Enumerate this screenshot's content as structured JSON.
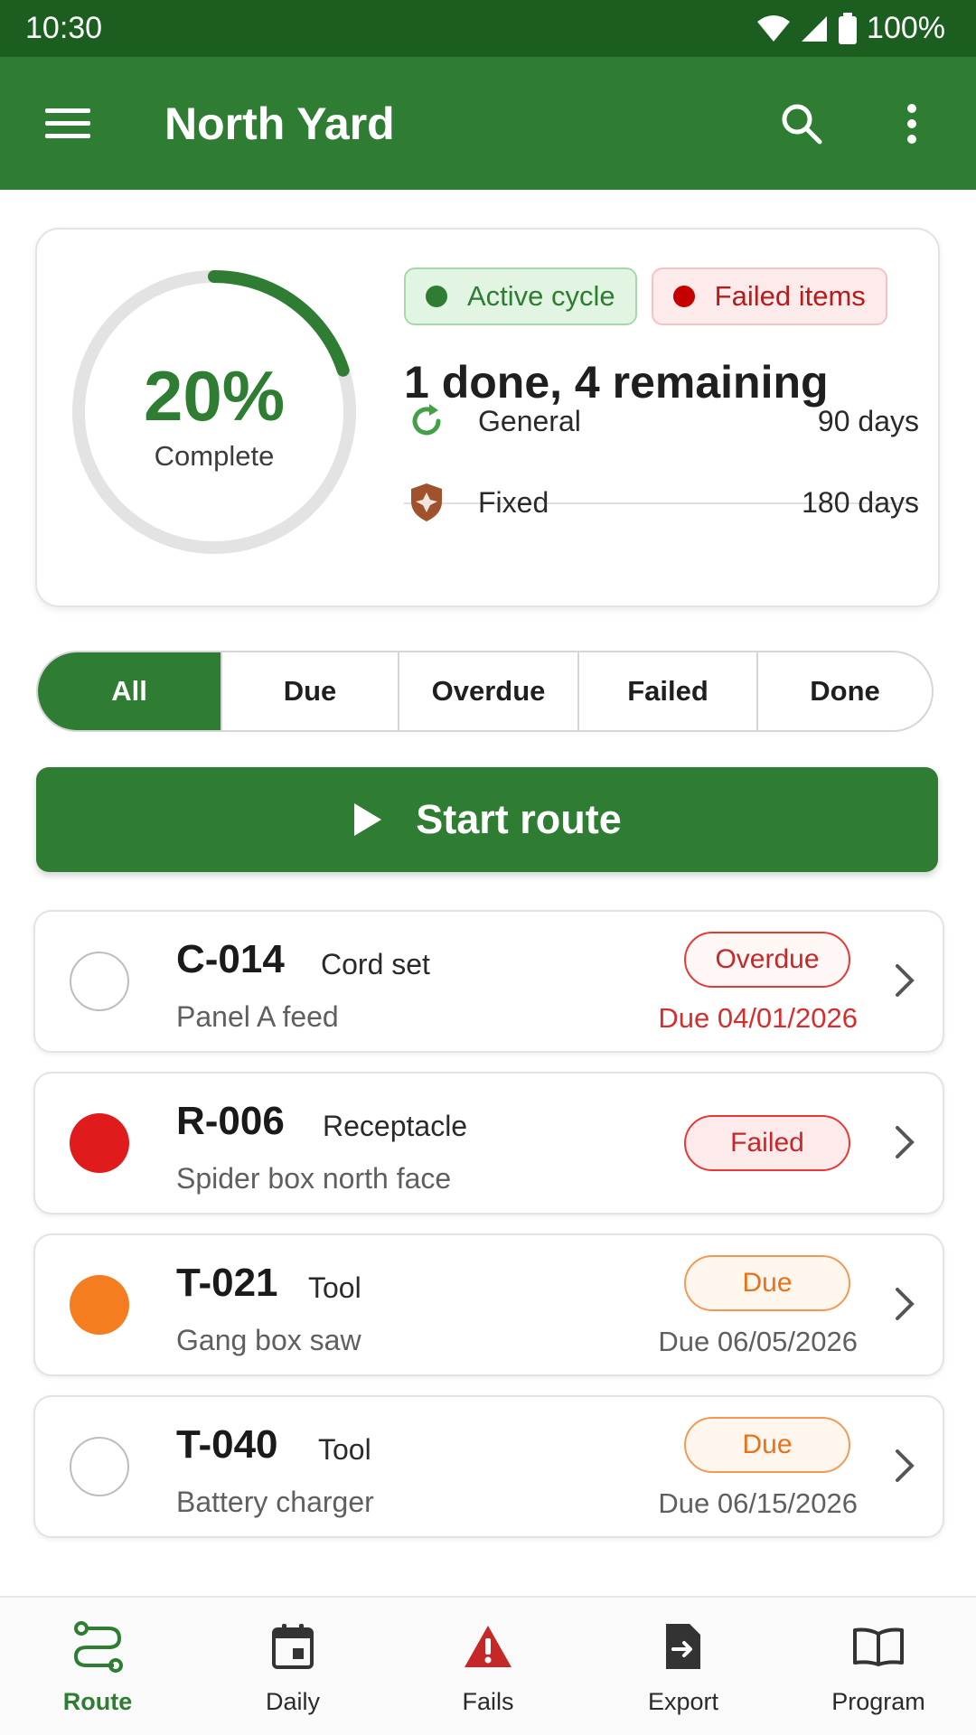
{
  "status_bar": {
    "time": "10:30",
    "battery": "100%"
  },
  "app_bar": {
    "title": "North Yard"
  },
  "summary": {
    "progress_percent": 20,
    "percent_label": "20%",
    "complete_label": "Complete",
    "badges": {
      "active": "Active cycle",
      "failed": "Failed items"
    },
    "headline": "1 done, 4 remaining",
    "intervals": [
      {
        "name": "General",
        "value": "90 days",
        "icon": "refresh-icon"
      },
      {
        "name": "Fixed",
        "value": "180 days",
        "icon": "shield-icon"
      }
    ]
  },
  "filters": [
    "All",
    "Due",
    "Overdue",
    "Failed",
    "Done"
  ],
  "start_route_label": "Start route",
  "items": [
    {
      "id": "C-014",
      "type": "Cord set",
      "location": "Panel A feed",
      "badge": "Overdue",
      "date": "Due 04/01/2026"
    },
    {
      "id": "R-006",
      "type": "Receptacle",
      "location": "Spider box north face",
      "badge": "Failed",
      "date": ""
    },
    {
      "id": "T-021",
      "type": "Tool",
      "location": "Gang box saw",
      "badge": "Due",
      "date": "Due 06/05/2026"
    },
    {
      "id": "T-040",
      "type": "Tool",
      "location": "Battery charger",
      "badge": "Due",
      "date": "Due 06/15/2026"
    }
  ],
  "bottom_nav": [
    "Route",
    "Daily",
    "Fails",
    "Export",
    "Program"
  ],
  "colors": {
    "primary": "#2e7d32",
    "primary_dark": "#1b5e20",
    "failed": "#e01b1b",
    "due": "#f57c1f"
  }
}
